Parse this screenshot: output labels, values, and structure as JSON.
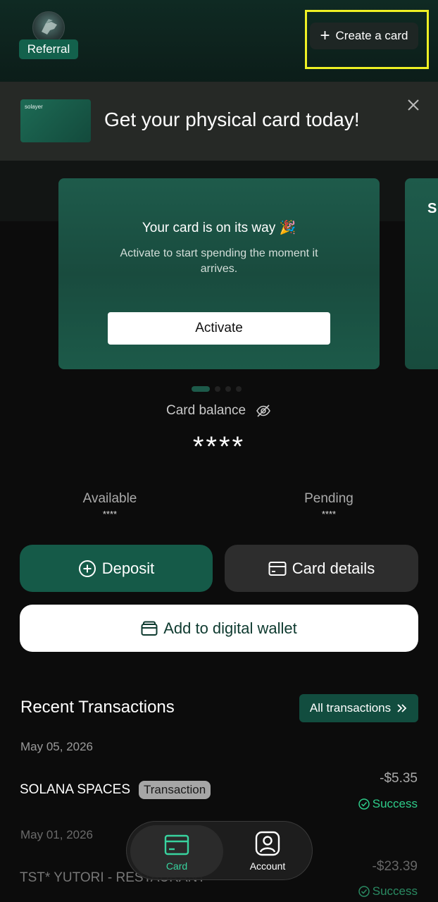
{
  "header": {
    "referral_label": "Referral",
    "create_card_label": "Create a card"
  },
  "banner": {
    "card_brand": "solayer",
    "title": "Get your physical card today!"
  },
  "carousel": {
    "card_title": "Your card is on its way 🎉",
    "card_subtitle": "Activate to start spending the moment it arrives.",
    "activate_label": "Activate",
    "next_card_logo": "S",
    "page_count": 4,
    "active_page": 1
  },
  "balance": {
    "label": "Card balance",
    "value": "****",
    "available_label": "Available",
    "available_value": "****",
    "pending_label": "Pending",
    "pending_value": "****"
  },
  "actions": {
    "deposit_label": "Deposit",
    "card_details_label": "Card details",
    "wallet_label": "Add to digital wallet"
  },
  "transactions": {
    "title": "Recent Transactions",
    "all_label": "All transactions",
    "groups": [
      {
        "date": "May 05, 2026",
        "merchant": "SOLANA SPACES",
        "tag": "Transaction",
        "amount": "-$5.35",
        "status": "Success"
      },
      {
        "date": "May 01, 2026",
        "merchant": "TST* YUTORI - RESTAURANT",
        "tag": "Transaction",
        "amount": "-$23.39",
        "status": "Success"
      }
    ]
  },
  "nav": {
    "card_label": "Card",
    "account_label": "Account"
  },
  "colors": {
    "accent_green": "#155a48",
    "status_green": "#2ecc8a",
    "nav_active": "#38d39f",
    "highlight": "#eef024"
  },
  "icons": [
    "plus-icon",
    "close-icon",
    "eye-off-icon",
    "plus-circle-icon",
    "card-icon",
    "wallet-icon",
    "chevrons-right-icon",
    "check-circle-icon",
    "user-icon"
  ]
}
